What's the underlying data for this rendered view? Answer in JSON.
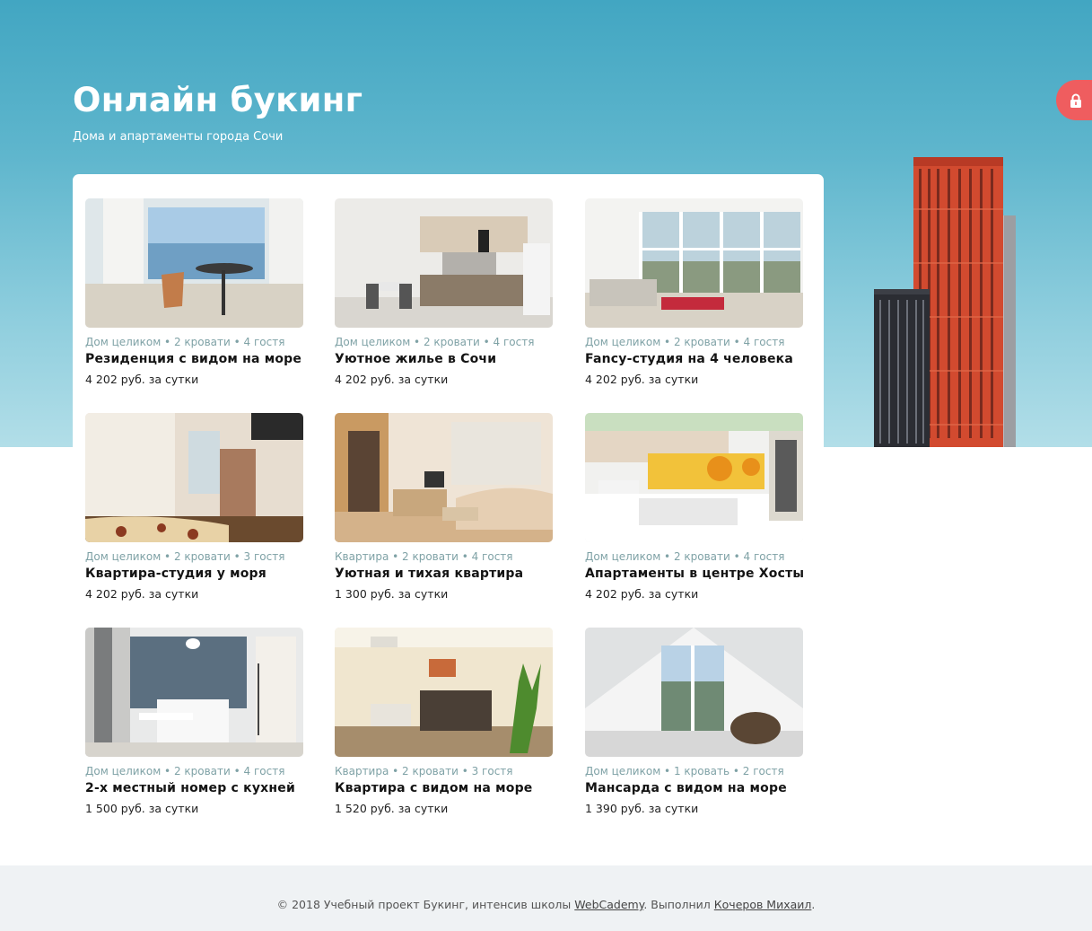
{
  "header": {
    "title": "Онлайн букинг",
    "subtitle": "Дома и апартаменты города Сочи"
  },
  "icons": {
    "lock": "lock-icon",
    "lock_bg_color": "#ef5d5f"
  },
  "listings": [
    {
      "meta": "Дом целиком • 2 кровати • 4 гостя",
      "title": "Резиденция с видом на море",
      "price": "4 202 руб. за сутки",
      "photo": "seaview-balcony-dining"
    },
    {
      "meta": "Дом целиком • 2 кровати • 4 гостя",
      "title": "Уютное жилье в Сочи",
      "price": "4 202 руб. за сутки",
      "photo": "kitchen-with-dining-table"
    },
    {
      "meta": "Дом целиком • 2 кровати • 4 гостя",
      "title": "Fancy-студия на 4 человека",
      "price": "4 202 руб. за сутки",
      "photo": "glazed-studio-sofa"
    },
    {
      "meta": "Дом целиком • 2 кровати • 3 гостя",
      "title": "Квартира-студия у моря",
      "price": "4 202 руб. за сутки",
      "photo": "studio-bed-floral"
    },
    {
      "meta": "Квартира • 2 кровати • 4 гостя",
      "title": "Уютная и тихая квартира",
      "price": "1 300 руб. за сутки",
      "photo": "living-room-sofa"
    },
    {
      "meta": "Дом целиком • 2 кровати • 4 гостя",
      "title": "Апартаменты в центре Хосты",
      "price": "4 202 руб. за сутки",
      "photo": "kitchen-yellow-backsplash"
    },
    {
      "meta": "Дом целиком • 2 кровати • 4 гостя",
      "title": "2-х местный номер с кухней",
      "price": "1 500 руб. за сутки",
      "photo": "white-kitchenette"
    },
    {
      "meta": "Квартира • 2 кровати • 3 гостя",
      "title": "Квартира с видом на море",
      "price": "1 520 руб. за сутки",
      "photo": "bedroom-with-plant"
    },
    {
      "meta": "Дом целиком • 1 кровать • 2 гостя",
      "title": "Мансарда с видом на море",
      "price": "1 390 руб. за сутки",
      "photo": "attic-mountain-view"
    }
  ],
  "footer": {
    "text_before": "© 2018 Учебный проект Букинг, интенсив школы ",
    "school_link": "WebCademy",
    "text_middle": ". Выполнил ",
    "author_link": "Кочеров Михаил",
    "text_after": "."
  },
  "colors": {
    "hero_top": "#42a6c2",
    "hero_bottom": "#b2dee8",
    "meta_text": "#7fa2a6",
    "footer_bg": "#eff2f4"
  }
}
